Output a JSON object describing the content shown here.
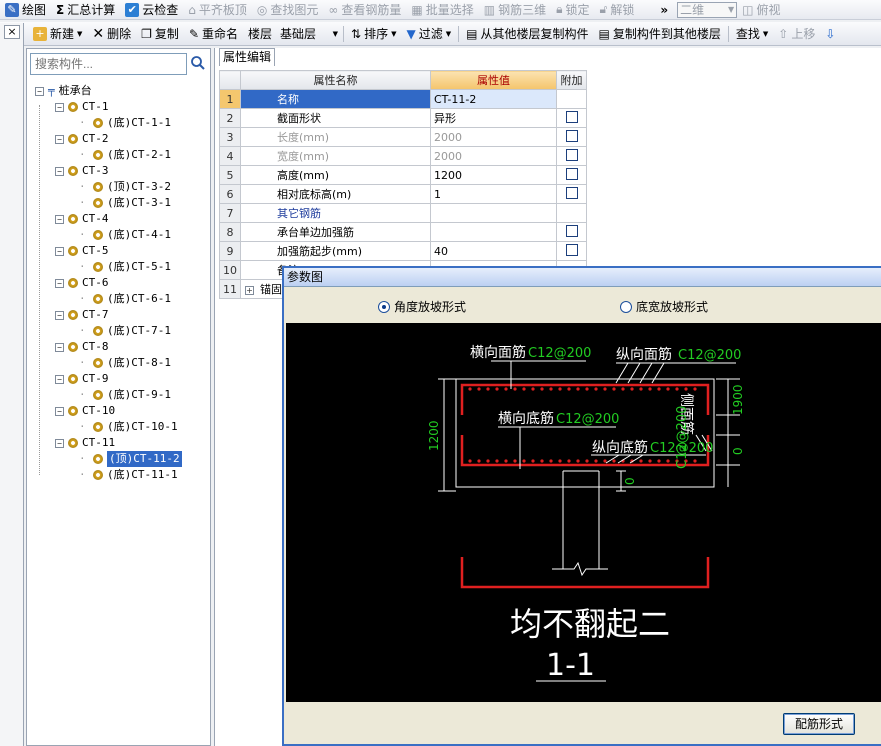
{
  "toolbar1": {
    "items": [
      "绘图",
      "汇总计算",
      "云检查",
      "平齐板顶",
      "查找图元",
      "查看钢筋量",
      "批量选择",
      "钢筋三维",
      "锁定",
      "解锁"
    ],
    "view_select": "二维",
    "view_label": "俯视",
    "overflow": "»"
  },
  "toolbar2": {
    "new": "新建",
    "delete": "删除",
    "copy": "复制",
    "rename": "重命名",
    "floor_label": "楼层",
    "floor_value": "基础层",
    "sort": "排序",
    "filter": "过滤",
    "copy_from": "从其他楼层复制构件",
    "copy_to": "复制构件到其他楼层",
    "find": "查找",
    "up": "上移"
  },
  "left_panel": {
    "close": "×"
  },
  "tree": {
    "search_placeholder": "搜索构件...",
    "root": "桩承台",
    "nodes": [
      {
        "name": "CT-1",
        "children": [
          "(底)CT-1-1"
        ]
      },
      {
        "name": "CT-2",
        "children": [
          "(底)CT-2-1"
        ]
      },
      {
        "name": "CT-3",
        "children": [
          "(顶)CT-3-2",
          "(底)CT-3-1"
        ]
      },
      {
        "name": "CT-4",
        "children": [
          "(底)CT-4-1"
        ]
      },
      {
        "name": "CT-5",
        "children": [
          "(底)CT-5-1"
        ]
      },
      {
        "name": "CT-6",
        "children": [
          "(底)CT-6-1"
        ]
      },
      {
        "name": "CT-7",
        "children": [
          "(底)CT-7-1"
        ]
      },
      {
        "name": "CT-8",
        "children": [
          "(底)CT-8-1"
        ]
      },
      {
        "name": "CT-9",
        "children": [
          "(底)CT-9-1"
        ]
      },
      {
        "name": "CT-10",
        "children": [
          "(底)CT-10-1"
        ]
      },
      {
        "name": "CT-11",
        "children": [
          "(顶)CT-11-2",
          "(底)CT-11-1"
        ]
      }
    ],
    "selected": "(顶)CT-11-2"
  },
  "props": {
    "tab": "属性编辑",
    "headers": [
      "属性名称",
      "属性值",
      "附加"
    ],
    "rows": [
      {
        "n": "1",
        "name": "名称",
        "value": "CT-11-2",
        "check": false,
        "style": "sel"
      },
      {
        "n": "2",
        "name": "截面形状",
        "value": "异形",
        "check": true,
        "style": ""
      },
      {
        "n": "3",
        "name": "长度(mm)",
        "value": "2000",
        "check": true,
        "style": "gray"
      },
      {
        "n": "4",
        "name": "宽度(mm)",
        "value": "2000",
        "check": true,
        "style": "gray"
      },
      {
        "n": "5",
        "name": "高度(mm)",
        "value": "1200",
        "check": true,
        "style": ""
      },
      {
        "n": "6",
        "name": "相对底标高(m)",
        "value": "1",
        "check": true,
        "style": ""
      },
      {
        "n": "7",
        "name": "其它钢筋",
        "value": "",
        "check": false,
        "style": "blue"
      },
      {
        "n": "8",
        "name": "承台单边加强筋",
        "value": "",
        "check": true,
        "style": ""
      },
      {
        "n": "9",
        "name": "加强筋起步(mm)",
        "value": "40",
        "check": true,
        "style": ""
      },
      {
        "n": "10",
        "name": "备注",
        "value": "",
        "check": false,
        "style": ""
      },
      {
        "n": "11",
        "name": "锚固",
        "value": "",
        "check": false,
        "style": "plus"
      }
    ]
  },
  "dialog": {
    "title": "参数图",
    "radio1": "角度放坡形式",
    "radio2": "底宽放坡形式",
    "button": "配筋形式",
    "drawing": {
      "top_transverse": "横向面筋",
      "top_transverse_val": "C12@200",
      "top_longitudinal": "纵向面筋",
      "top_longitudinal_val": "C12@200",
      "bot_transverse": "横向底筋",
      "bot_transverse_val": "C12@200",
      "bot_longitudinal": "纵向底筋",
      "bot_longitudinal_val": "C12@200",
      "side_label": "侧面筋",
      "side_val": "C12@200",
      "dim_left": "1200",
      "dim_right_top": "1900",
      "dim_right_bot": "0",
      "dim_under": "0",
      "caption": "均不翻起二",
      "section": "1-1"
    },
    "colors": {
      "rebar": "#e02020",
      "label": "#ffffff",
      "value": "#22cc22",
      "line": "#ffffff"
    }
  }
}
